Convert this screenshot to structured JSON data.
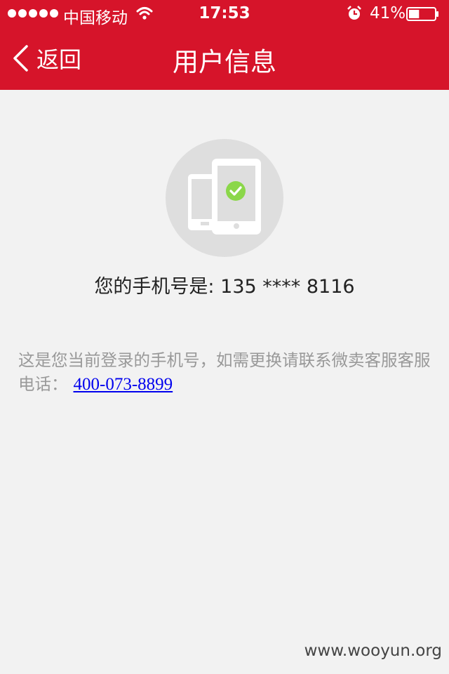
{
  "status_bar": {
    "carrier": "中国移动",
    "time": "17:53",
    "battery_percent": "41%",
    "battery_level": 0.41,
    "signal_bars": 5,
    "icons": [
      "signal-dots-icon",
      "wifi-icon",
      "alarm-icon",
      "battery-icon"
    ]
  },
  "nav": {
    "back_label": "返回",
    "title": "用户信息"
  },
  "hero": {
    "icon": "phone-verified-icon"
  },
  "phone": {
    "label": "您的手机号是:",
    "number": "135 **** 8116"
  },
  "notice": {
    "text": "这是您当前登录的手机号，如需更换请联系微卖客服客服电话：",
    "hotline": "400-073-8899"
  },
  "watermark": "www.wooyun.org",
  "colors": {
    "header": "#d6142a",
    "background": "#f2f2f2",
    "hero_circle": "#dedede",
    "check": "#8bd74a",
    "notice_text": "#999999",
    "link": "#0000ee"
  }
}
